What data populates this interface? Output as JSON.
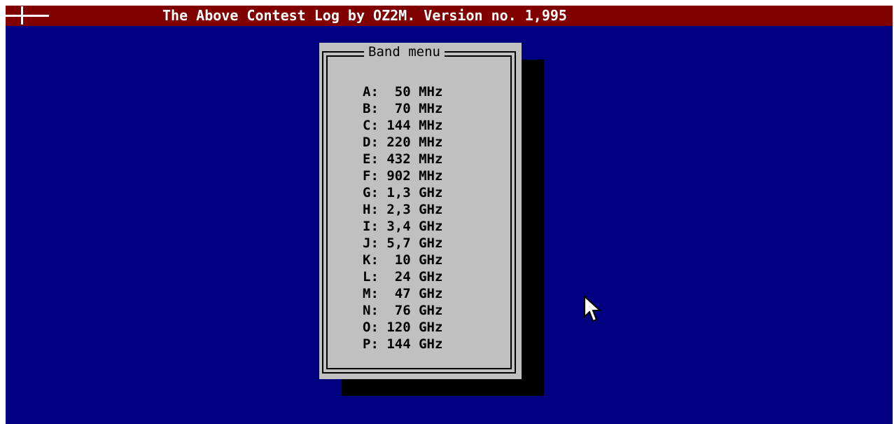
{
  "titlebar": {
    "title": "The Above Contest Log by OZ2M. Version no. 1,995"
  },
  "dialog": {
    "title": "Band menu",
    "items": [
      {
        "key": "A:",
        "freq": "  50",
        "unit": "MHz"
      },
      {
        "key": "B:",
        "freq": "  70",
        "unit": "MHz"
      },
      {
        "key": "C:",
        "freq": " 144",
        "unit": "MHz"
      },
      {
        "key": "D:",
        "freq": " 220",
        "unit": "MHz"
      },
      {
        "key": "E:",
        "freq": " 432",
        "unit": "MHz"
      },
      {
        "key": "F:",
        "freq": " 902",
        "unit": "MHz"
      },
      {
        "key": "G:",
        "freq": " 1,3",
        "unit": "GHz"
      },
      {
        "key": "H:",
        "freq": " 2,3",
        "unit": "GHz"
      },
      {
        "key": "I:",
        "freq": " 3,4",
        "unit": "GHz"
      },
      {
        "key": "J:",
        "freq": " 5,7",
        "unit": "GHz"
      },
      {
        "key": "K:",
        "freq": "  10",
        "unit": "GHz"
      },
      {
        "key": "L:",
        "freq": "  24",
        "unit": "GHz"
      },
      {
        "key": "M:",
        "freq": "  47",
        "unit": "GHz"
      },
      {
        "key": "N:",
        "freq": "  76",
        "unit": "GHz"
      },
      {
        "key": "O:",
        "freq": " 120",
        "unit": "GHz"
      },
      {
        "key": "P:",
        "freq": " 144",
        "unit": "GHz"
      }
    ]
  },
  "icons": {
    "system_menu": "system-menu-icon",
    "pointer": "mouse-pointer-icon"
  },
  "colors": {
    "desktop": "#000080",
    "titlebar": "#800000",
    "dialog": "#c0c0c0",
    "shadow": "#000000"
  }
}
